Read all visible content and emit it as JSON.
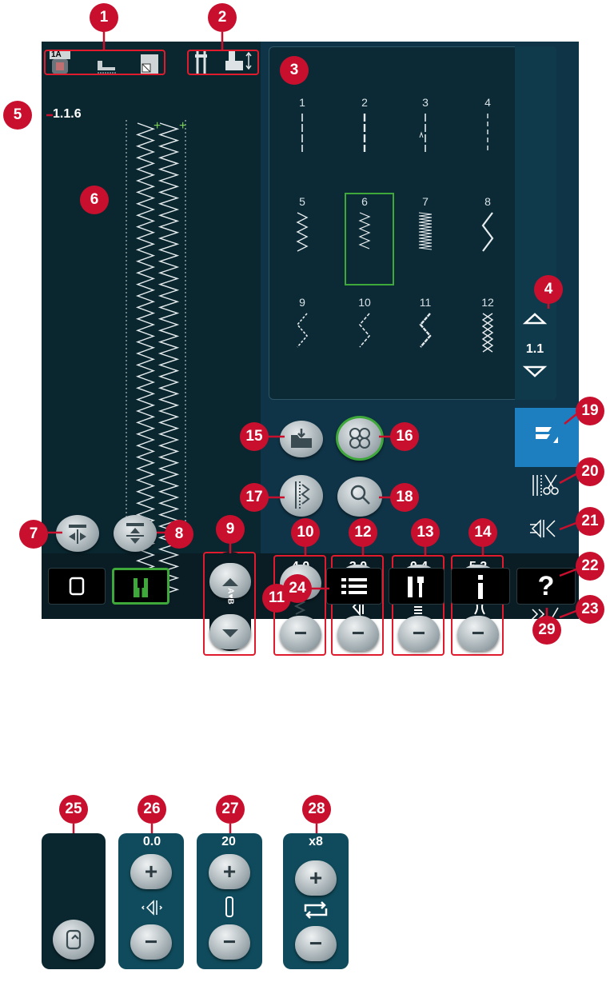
{
  "callouts": [
    "1",
    "2",
    "3",
    "4",
    "5",
    "6",
    "7",
    "8",
    "9",
    "10",
    "11",
    "12",
    "13",
    "14",
    "15",
    "16",
    "17",
    "18",
    "19",
    "20",
    "21",
    "22",
    "23",
    "24",
    "25",
    "26",
    "27",
    "28",
    "29"
  ],
  "stitch_number": "1.1.6",
  "presser_foot_label": "1A",
  "stitch_menu": {
    "items": [
      "1",
      "2",
      "3",
      "4",
      "5",
      "6",
      "7",
      "8",
      "9",
      "10",
      "11",
      "12"
    ],
    "page": "1.1"
  },
  "adjustments": {
    "width": "4.0",
    "length": "3.0",
    "density": "0.4",
    "position": "5.2"
  },
  "mirror_label": "A♥B",
  "bottom_panels": {
    "tapering": "0.0",
    "stitch_repeat": "20",
    "repetitions": "x8"
  },
  "colors": {
    "screen": "#0f3447",
    "accent_green": "#3fa83a",
    "callout_red": "#c8102e",
    "active_blue": "#1e7fc0"
  },
  "icons": [
    "presser-foot-icon",
    "stitch-plate-icon",
    "needle-icon",
    "presser-foot-lift-icon",
    "mirror-side-icon",
    "mirror-end-icon",
    "save-icon",
    "shapes-icon",
    "zoom-icon",
    "sequence-icon",
    "embroidery-mode-icon",
    "cut-icon",
    "tapering-icon",
    "mirror-edit-icon",
    "stitch-edit-icon",
    "menu-icon",
    "settings-icon",
    "info-icon",
    "help-icon",
    "restart-icon",
    "loop-icon"
  ]
}
